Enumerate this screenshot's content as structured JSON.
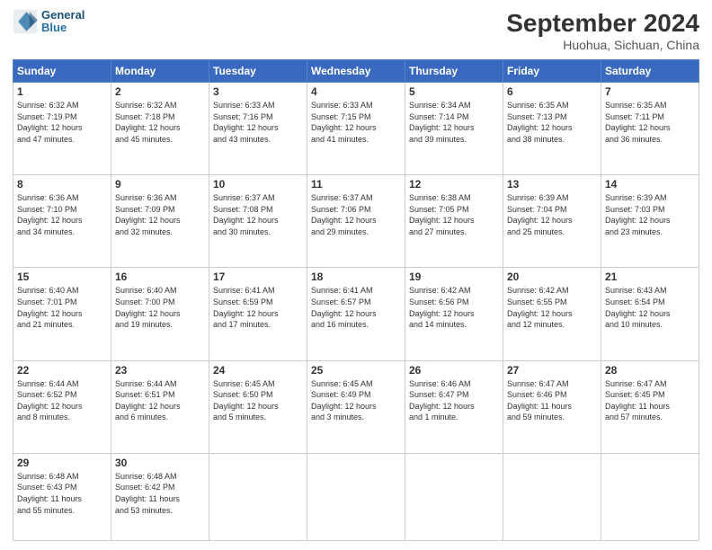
{
  "header": {
    "logo_line1": "General",
    "logo_line2": "Blue",
    "title": "September 2024",
    "subtitle": "Huohua, Sichuan, China"
  },
  "weekdays": [
    "Sunday",
    "Monday",
    "Tuesday",
    "Wednesday",
    "Thursday",
    "Friday",
    "Saturday"
  ],
  "weeks": [
    [
      {
        "day": "1",
        "sunrise": "6:32 AM",
        "sunset": "7:19 PM",
        "daylight": "12 hours and 47 minutes."
      },
      {
        "day": "2",
        "sunrise": "6:32 AM",
        "sunset": "7:18 PM",
        "daylight": "12 hours and 45 minutes."
      },
      {
        "day": "3",
        "sunrise": "6:33 AM",
        "sunset": "7:16 PM",
        "daylight": "12 hours and 43 minutes."
      },
      {
        "day": "4",
        "sunrise": "6:33 AM",
        "sunset": "7:15 PM",
        "daylight": "12 hours and 41 minutes."
      },
      {
        "day": "5",
        "sunrise": "6:34 AM",
        "sunset": "7:14 PM",
        "daylight": "12 hours and 39 minutes."
      },
      {
        "day": "6",
        "sunrise": "6:35 AM",
        "sunset": "7:13 PM",
        "daylight": "12 hours and 38 minutes."
      },
      {
        "day": "7",
        "sunrise": "6:35 AM",
        "sunset": "7:11 PM",
        "daylight": "12 hours and 36 minutes."
      }
    ],
    [
      {
        "day": "8",
        "sunrise": "6:36 AM",
        "sunset": "7:10 PM",
        "daylight": "12 hours and 34 minutes."
      },
      {
        "day": "9",
        "sunrise": "6:36 AM",
        "sunset": "7:09 PM",
        "daylight": "12 hours and 32 minutes."
      },
      {
        "day": "10",
        "sunrise": "6:37 AM",
        "sunset": "7:08 PM",
        "daylight": "12 hours and 30 minutes."
      },
      {
        "day": "11",
        "sunrise": "6:37 AM",
        "sunset": "7:06 PM",
        "daylight": "12 hours and 29 minutes."
      },
      {
        "day": "12",
        "sunrise": "6:38 AM",
        "sunset": "7:05 PM",
        "daylight": "12 hours and 27 minutes."
      },
      {
        "day": "13",
        "sunrise": "6:39 AM",
        "sunset": "7:04 PM",
        "daylight": "12 hours and 25 minutes."
      },
      {
        "day": "14",
        "sunrise": "6:39 AM",
        "sunset": "7:03 PM",
        "daylight": "12 hours and 23 minutes."
      }
    ],
    [
      {
        "day": "15",
        "sunrise": "6:40 AM",
        "sunset": "7:01 PM",
        "daylight": "12 hours and 21 minutes."
      },
      {
        "day": "16",
        "sunrise": "6:40 AM",
        "sunset": "7:00 PM",
        "daylight": "12 hours and 19 minutes."
      },
      {
        "day": "17",
        "sunrise": "6:41 AM",
        "sunset": "6:59 PM",
        "daylight": "12 hours and 17 minutes."
      },
      {
        "day": "18",
        "sunrise": "6:41 AM",
        "sunset": "6:57 PM",
        "daylight": "12 hours and 16 minutes."
      },
      {
        "day": "19",
        "sunrise": "6:42 AM",
        "sunset": "6:56 PM",
        "daylight": "12 hours and 14 minutes."
      },
      {
        "day": "20",
        "sunrise": "6:42 AM",
        "sunset": "6:55 PM",
        "daylight": "12 hours and 12 minutes."
      },
      {
        "day": "21",
        "sunrise": "6:43 AM",
        "sunset": "6:54 PM",
        "daylight": "12 hours and 10 minutes."
      }
    ],
    [
      {
        "day": "22",
        "sunrise": "6:44 AM",
        "sunset": "6:52 PM",
        "daylight": "12 hours and 8 minutes."
      },
      {
        "day": "23",
        "sunrise": "6:44 AM",
        "sunset": "6:51 PM",
        "daylight": "12 hours and 6 minutes."
      },
      {
        "day": "24",
        "sunrise": "6:45 AM",
        "sunset": "6:50 PM",
        "daylight": "12 hours and 5 minutes."
      },
      {
        "day": "25",
        "sunrise": "6:45 AM",
        "sunset": "6:49 PM",
        "daylight": "12 hours and 3 minutes."
      },
      {
        "day": "26",
        "sunrise": "6:46 AM",
        "sunset": "6:47 PM",
        "daylight": "12 hours and 1 minute."
      },
      {
        "day": "27",
        "sunrise": "6:47 AM",
        "sunset": "6:46 PM",
        "daylight": "11 hours and 59 minutes."
      },
      {
        "day": "28",
        "sunrise": "6:47 AM",
        "sunset": "6:45 PM",
        "daylight": "11 hours and 57 minutes."
      }
    ],
    [
      {
        "day": "29",
        "sunrise": "6:48 AM",
        "sunset": "6:43 PM",
        "daylight": "11 hours and 55 minutes."
      },
      {
        "day": "30",
        "sunrise": "6:48 AM",
        "sunset": "6:42 PM",
        "daylight": "11 hours and 53 minutes."
      },
      null,
      null,
      null,
      null,
      null
    ]
  ]
}
